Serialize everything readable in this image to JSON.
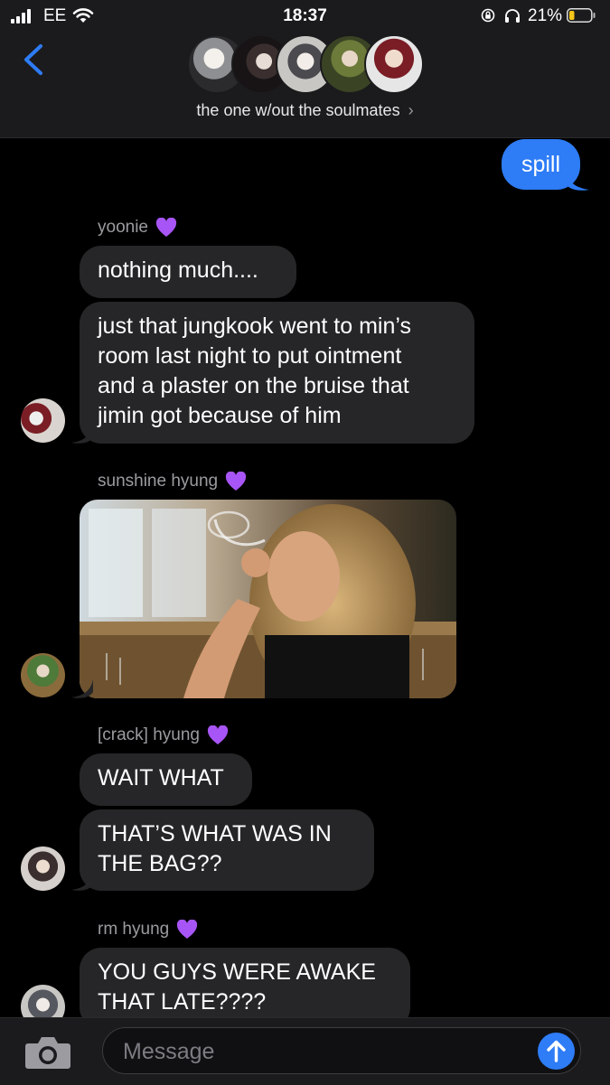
{
  "status_bar": {
    "carrier": "EE",
    "time": "18:37",
    "battery": "21%"
  },
  "header": {
    "group_name": "the one w/out the soulmates",
    "chevron": "›"
  },
  "messages": {
    "outgoing": {
      "text": "spill"
    },
    "yoonie": {
      "sender": "yoonie",
      "msg1": "nothing much....",
      "msg2_lines": [
        "just that jungkook went to min’s",
        "room last night to put ointment",
        "and a plaster on the bruise that",
        "jimin got because of him"
      ]
    },
    "sunshine": {
      "sender": "sunshine hyung"
    },
    "crack": {
      "sender": "[crack] hyung",
      "msg1": "WAIT WHAT",
      "msg2_lines": [
        "THAT’S WHAT WAS IN",
        "THE BAG??"
      ]
    },
    "rm": {
      "sender": "rm hyung",
      "msg1_lines": [
        "YOU GUYS WERE AWAKE",
        "THAT LATE????"
      ]
    }
  },
  "composer": {
    "placeholder": "Message"
  },
  "icons": {
    "back": "chevron-left-icon",
    "camera": "camera-icon",
    "send": "arrow-up-icon",
    "heart": "purple-heart-emoji"
  },
  "colors": {
    "accent_blue": "#2e7cf6",
    "incoming_bubble": "#262628",
    "heart_purple": "#a855f7"
  }
}
